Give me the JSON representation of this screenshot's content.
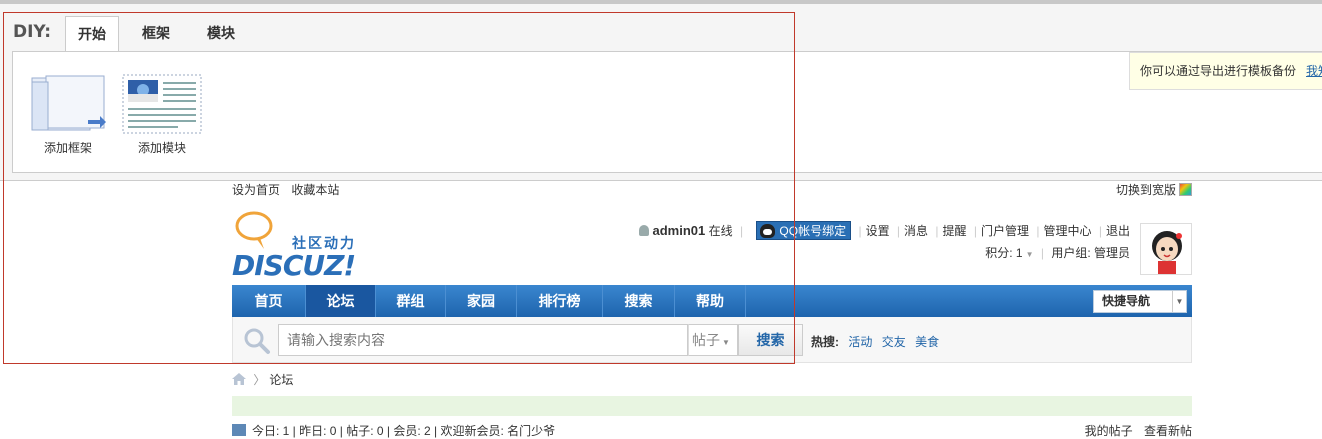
{
  "diy": {
    "label": "DIY:",
    "tabs": [
      {
        "label": "开始"
      },
      {
        "label": "框架"
      },
      {
        "label": "模块"
      }
    ],
    "tools": [
      {
        "label": "添加框架"
      },
      {
        "label": "添加模块"
      }
    ],
    "tip": "你可以通过导出进行模板备份",
    "tip_link": "我知"
  },
  "topbar": {
    "set_home": "设为首页",
    "bookmark": "收藏本站",
    "switch_wide": "切换到宽版"
  },
  "logo": {
    "slogan": "社区动力",
    "word": "DISCUZ!"
  },
  "user": {
    "name": "admin01",
    "status": "在线",
    "qq_bind": "QQ帐号绑定",
    "links": [
      "设置",
      "消息",
      "提醒",
      "门户管理",
      "管理中心",
      "退出"
    ],
    "points_label": "积分: 1",
    "group_label": "用户组: 管理员"
  },
  "nav": {
    "items": [
      {
        "label": "首页"
      },
      {
        "label": "论坛"
      },
      {
        "label": "群组"
      },
      {
        "label": "家园"
      },
      {
        "label": "排行榜"
      },
      {
        "label": "搜索"
      },
      {
        "label": "帮助"
      }
    ],
    "quick_nav": "快捷导航"
  },
  "search": {
    "placeholder": "请输入搜索内容",
    "type": "帖子",
    "button": "搜索",
    "hot_label": "热搜:",
    "hot_items": [
      "活动",
      "交友",
      "美食"
    ]
  },
  "breadcrumb": {
    "current": "论坛"
  },
  "stats": {
    "text": "今日: 1 | 昨日: 0 | 帖子: 0 | 会员: 2 | 欢迎新会员: 名门少爷",
    "my_posts": "我的帖子",
    "new_posts": "查看新帖"
  },
  "colors": {
    "accent": "#2366a8",
    "nav_bg": "#1e64ad",
    "selection": "#c0392b"
  }
}
